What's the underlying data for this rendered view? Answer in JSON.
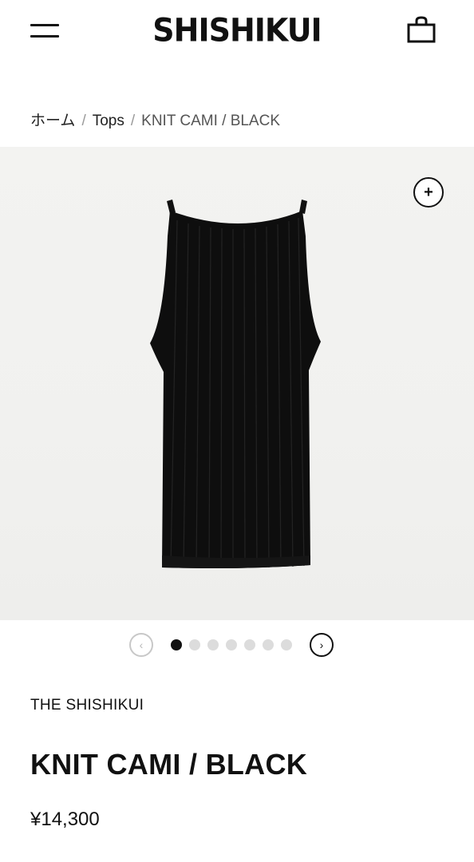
{
  "header": {
    "logo_text": "SHISHIKUI",
    "menu_icon": "hamburger-menu-icon",
    "cart_icon": "shopping-bag-icon"
  },
  "breadcrumb": {
    "items": [
      "ホーム",
      "Tops"
    ],
    "current": "KNIT CAMI / BLACK",
    "separator": "/"
  },
  "gallery": {
    "zoom_icon": "plus-icon",
    "prev_icon": "chevron-left-icon",
    "next_icon": "chevron-right-icon",
    "prev_glyph": "‹",
    "next_glyph": "›",
    "zoom_glyph": "+",
    "slide_count": 7,
    "active_slide": 1
  },
  "product": {
    "brand": "THE SHISHIKUI",
    "title": "KNIT CAMI / BLACK",
    "price": "¥14,300"
  },
  "colors": {
    "text": "#111111",
    "image_bg": "#f2f2f0",
    "garment": "#0e0e0e",
    "dot_inactive": "#dcdcdc"
  }
}
